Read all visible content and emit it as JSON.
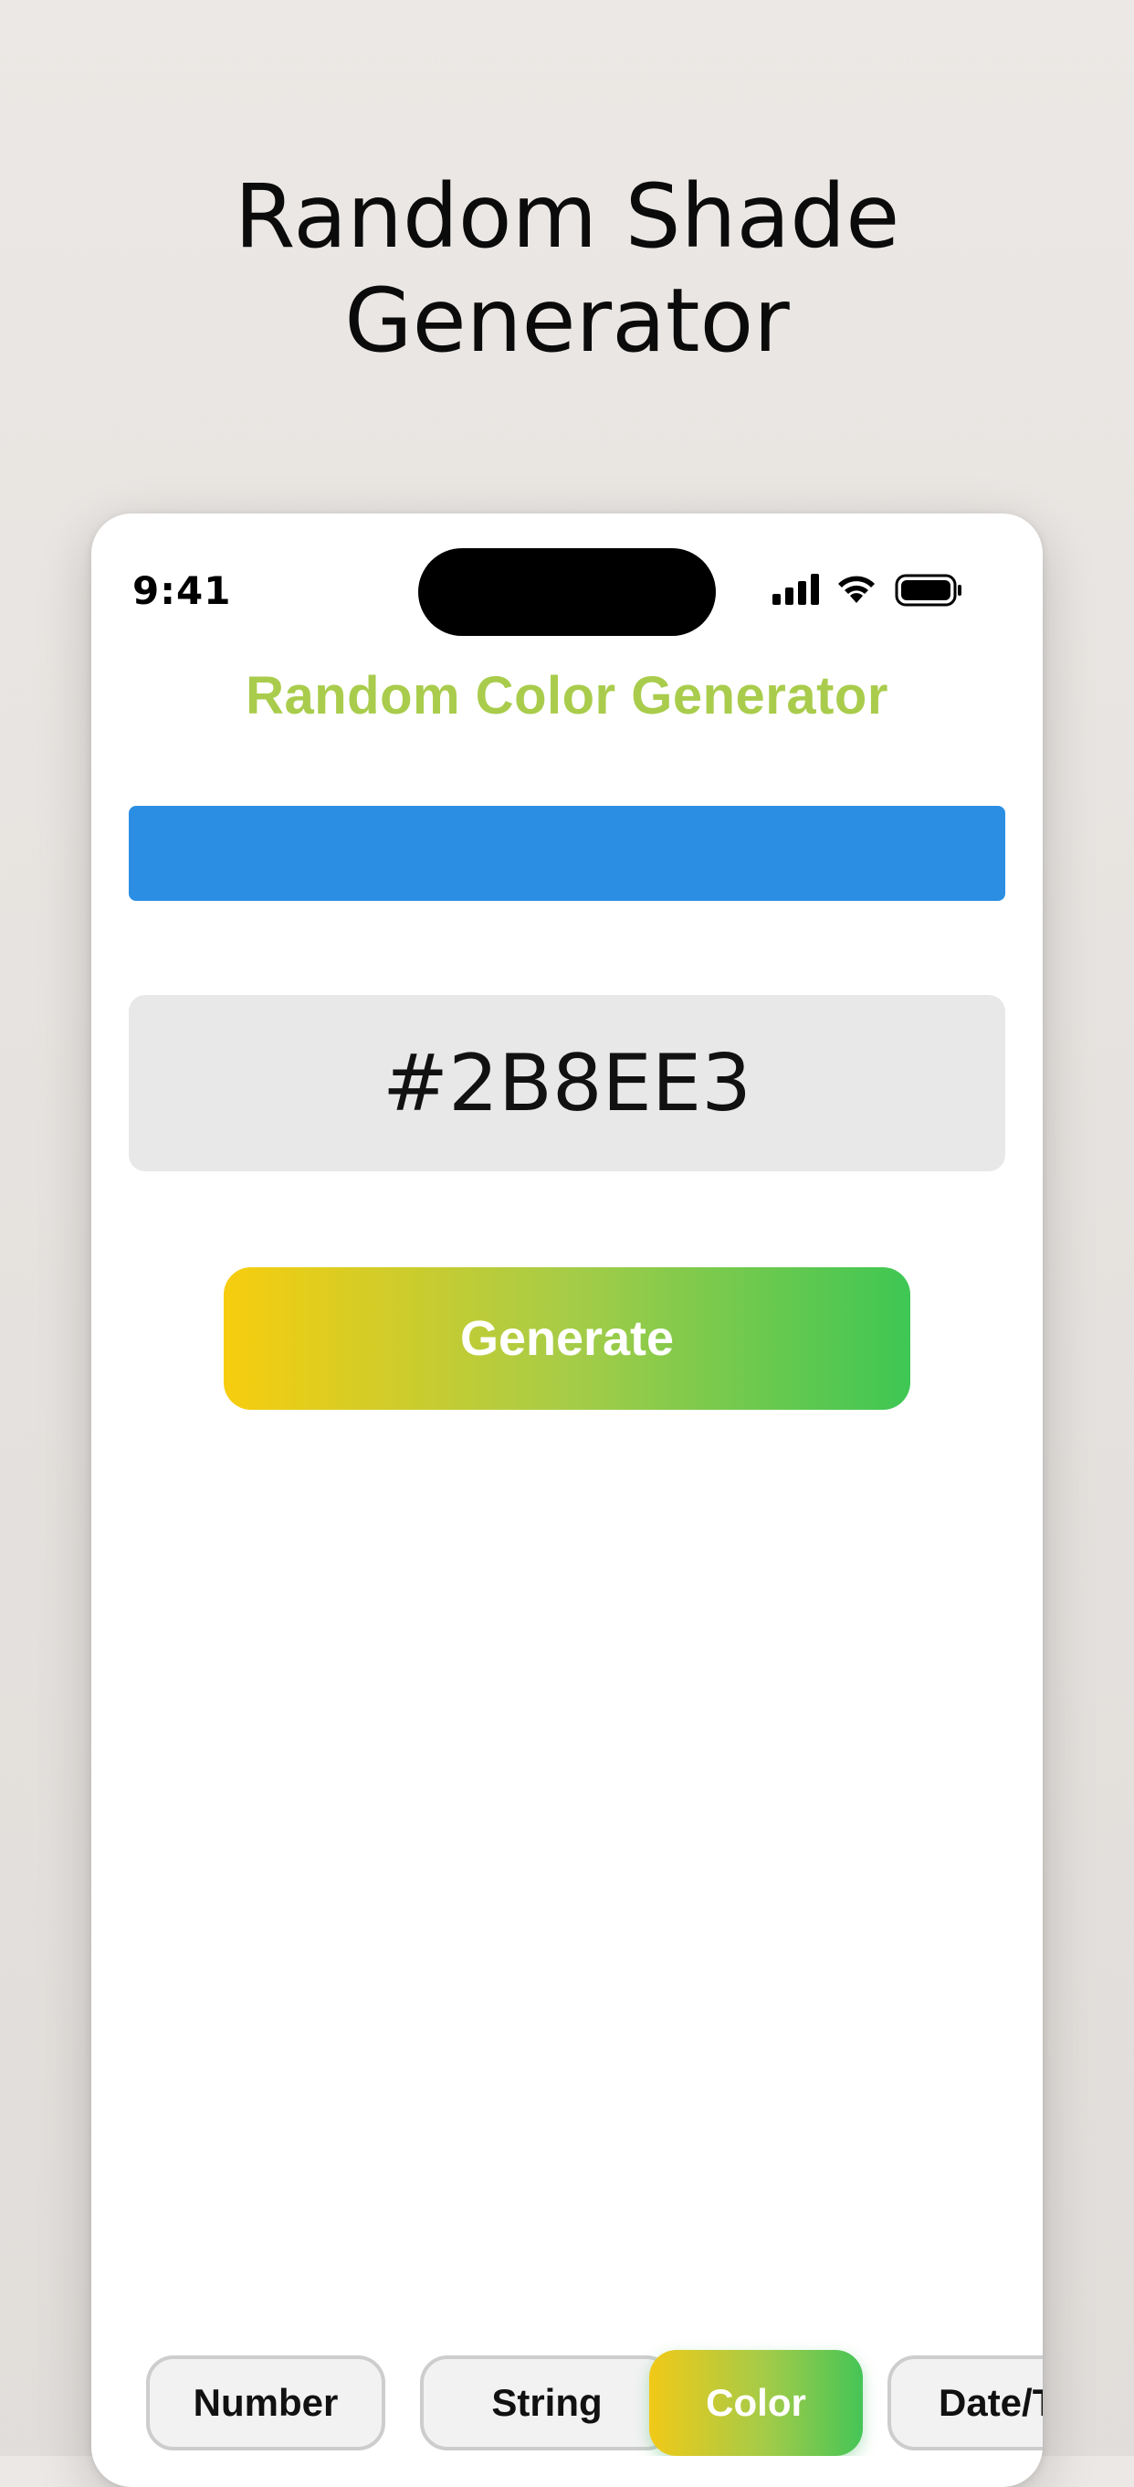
{
  "promo": {
    "title_line1": "Random Shade",
    "title_line2": "Generator"
  },
  "status_bar": {
    "time": "9:41",
    "icons": [
      "cellular-signal-icon",
      "wifi-icon",
      "battery-icon"
    ]
  },
  "app": {
    "title": "Random Color Generator",
    "title_color": "#A9CC4C",
    "current_color": "#2B8EE3",
    "hex_value": "#2B8EE3",
    "generate_label": "Generate",
    "generate_gradient": [
      "#F7CD0E",
      "#3EC754"
    ]
  },
  "tabs": [
    {
      "label": "Number",
      "active": false
    },
    {
      "label": "String",
      "active": false
    },
    {
      "label": "Color",
      "active": true
    },
    {
      "label": "Date/T",
      "active": false
    }
  ]
}
